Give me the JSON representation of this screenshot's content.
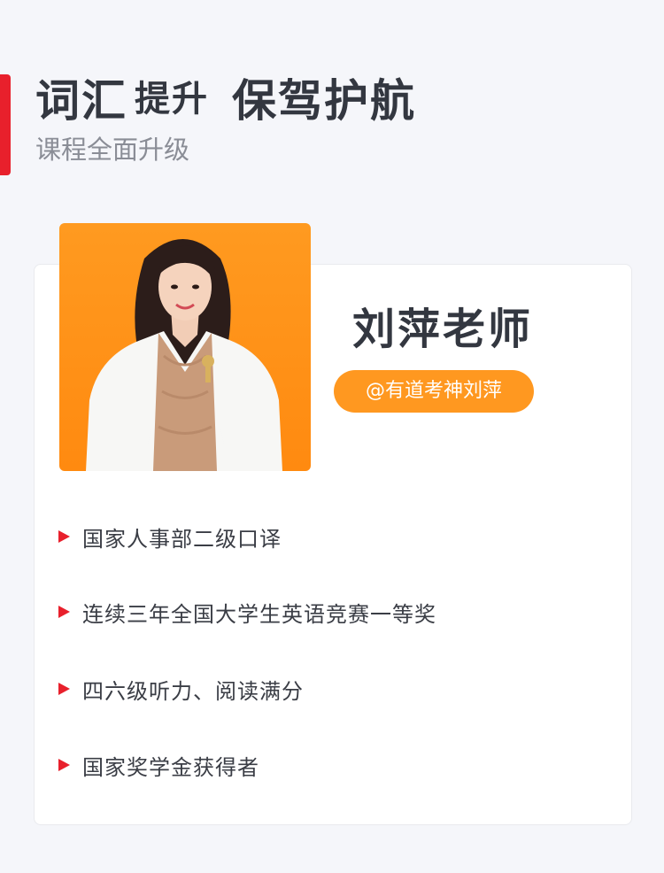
{
  "header": {
    "word1": "词汇",
    "word2": "提升",
    "word3": "保驾护航",
    "subtitle": "课程全面升级"
  },
  "teacher": {
    "name": "刘萍老师",
    "handle": "@有道考神刘萍"
  },
  "credentials": [
    "国家人事部二级口译",
    "连续三年全国大学生英语竞赛一等奖",
    "四六级听力、阅读满分",
    "国家奖学金获得者"
  ],
  "colors": {
    "accent_red": "#e8202c",
    "orange": "#ff9820",
    "text_dark": "#333740",
    "text_gray": "#8a8d96"
  },
  "icons": {
    "bullet": "red-triangle-icon"
  }
}
